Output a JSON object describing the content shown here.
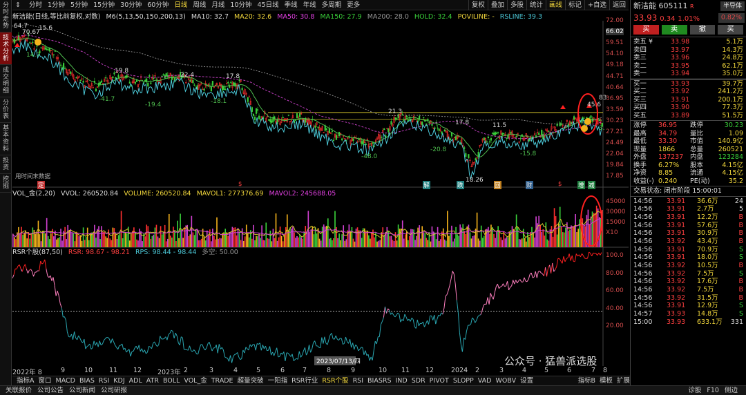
{
  "left_tabs": [
    "分时走势",
    "技术分析",
    "成交明细",
    "分价表",
    "基本资料",
    "投资",
    "挖掘"
  ],
  "top_periods": [
    "分时",
    "1分钟",
    "5分钟",
    "15分钟",
    "30分钟",
    "60分钟",
    "日线",
    "周线",
    "月线",
    "10分钟",
    "45日线",
    "季线",
    "年线",
    "多周期",
    "更多"
  ],
  "top_active": "日线",
  "top_buttons": [
    "复权",
    "叠加",
    "多股",
    "统计",
    "画线",
    "标记",
    "+自选",
    "返回"
  ],
  "legend": {
    "title": "新洁能(日线,等比前复权,对数)",
    "m6": "M6(5,13,50,150,200,13)",
    "ma10": "MA10: 32.7",
    "ma20": "MA20: 32.6",
    "ma50": "MA50: 30.8",
    "ma150": "MA150: 27.9",
    "ma200": "MA200: 28.0",
    "hold": "HOLD: 32.4",
    "poviline": "POVILINE: -",
    "rsline": "RSLINE: 39.3"
  },
  "price_axis": [
    "72.00",
    "66.02",
    "59.51",
    "54.10",
    "49.18",
    "44.71",
    "40.64",
    "36.95",
    "33.59",
    "30.23",
    "27.21",
    "24.49",
    "22.04",
    "19.84",
    "17.85"
  ],
  "price_labels": {
    "hi1": "64.7",
    "hi2": "70.67",
    "hi3": "15.6",
    "l1": "14.7",
    "p19_8": "19.8",
    "p22_4": "22.4",
    "p17_8": "17.8",
    "n41_7": "-41.7",
    "n19_4": "-19.4",
    "n18_1": "-18.1",
    "n48": "-48.0",
    "n20_8": "-20.8",
    "n15_8": "-15.8",
    "p17_8b": "17.8",
    "p11_5": "11.5",
    "low": "18.26",
    "p21_3": "21.3",
    "p45_6": "45.6",
    "p83": "83",
    "p3": "3."
  },
  "no_data_label": "用时间末数据",
  "vol_legend": {
    "name": "VOL_金(2,20)",
    "vvol": "VVOL: 260520.84",
    "volume": "VOLUME: 260520.84",
    "mavol1": "MAVOL1: 277376.69",
    "mavol2": "MAVOL2: 245688.05"
  },
  "vol_axis": [
    "45000",
    "30000",
    "15000",
    "X10"
  ],
  "rsr_legend": {
    "name": "RSR个股(87,50)",
    "rsr": "RSR: 98.67 - 98.21",
    "rps": "RPS: 98.44 - 98.44",
    "dk": "多空: 50.00"
  },
  "rsr_axis": [
    "100.0",
    "80.00",
    "60.00",
    "40.00",
    "20.00"
  ],
  "x_axis": [
    "2022年 8",
    "9",
    "10",
    "11",
    "12",
    "2023年",
    "2",
    "3",
    "4",
    "5",
    "6",
    "7",
    "8",
    "9",
    "10",
    "11",
    "12",
    "2024",
    "2",
    "3",
    "4",
    "5",
    "6",
    "7",
    "8"
  ],
  "x_tooltip": "2023/07/13/四",
  "bottom_tabs": [
    "指标A",
    "窗口",
    "MACD",
    "BIAS",
    "RSI",
    "KDJ",
    "ADL",
    "ATR",
    "BOLL",
    "VOL_金",
    "TRADE",
    "超量突破",
    "一阳指",
    "RSR行业",
    "RSR个股",
    "RSI",
    "BIASRS",
    "IND",
    "SDR",
    "PIVOT",
    "SLOPP",
    "VAD",
    "WOBV",
    "设置"
  ],
  "bottom_active": "RSR个股",
  "bottom_right": [
    "指标B",
    "模板",
    "扩展"
  ],
  "status": [
    "关联报价",
    "公司公告",
    "公司新闻",
    "公司研报"
  ],
  "status_right": [
    "诊股",
    "F10",
    "侧边"
  ],
  "watermark": "公众号 · 猛兽派选股",
  "stock": {
    "name": "新洁能",
    "code": "605111",
    "r": "R",
    "sector": "半导体",
    "price": "33.93",
    "chg": "0.34",
    "pct": "1.01%",
    "pct2": "0.82%"
  },
  "trade_btns": [
    "买",
    "卖",
    "撤",
    "买"
  ],
  "sell": [
    [
      "卖五",
      "¥",
      "33.98",
      "5.1万"
    ],
    [
      "卖四",
      "",
      "33.97",
      "14.3万"
    ],
    [
      "卖三",
      "",
      "33.96",
      "24.8万"
    ],
    [
      "卖二",
      "",
      "33.95",
      "62.1万"
    ],
    [
      "卖一",
      "",
      "33.94",
      "35.0万"
    ]
  ],
  "buy": [
    [
      "买一",
      "33.93",
      "39.7万"
    ],
    [
      "买二",
      "33.92",
      "241.2万"
    ],
    [
      "买三",
      "33.91",
      "200.1万"
    ],
    [
      "买四",
      "33.90",
      "77.3万"
    ],
    [
      "买五",
      "33.89",
      "51.5万"
    ]
  ],
  "stats": [
    [
      "涨停",
      "36.95",
      "跌停",
      "30.23"
    ],
    [
      "最高",
      "34.79",
      "量比",
      "1.09"
    ],
    [
      "最低",
      "33.30",
      "市值",
      "140.9亿"
    ],
    [
      "现量",
      "1866",
      "总量",
      "260521"
    ],
    [
      "外盘",
      "137237",
      "内盘",
      "123284"
    ],
    [
      "换手",
      "6.27%",
      "股本",
      "4.15亿"
    ],
    [
      "净资",
      "8.85",
      "流通",
      "4.15亿"
    ],
    [
      "收益(-)",
      "0.240",
      "PE(动)",
      "35.2"
    ]
  ],
  "trade_state": "交易状态: 闭市阶段 15:00:01",
  "ticks": [
    [
      "14:56",
      "33.91",
      "36.6万",
      "24"
    ],
    [
      "14:56",
      "33.91",
      "2.7万",
      "5"
    ],
    [
      "14:56",
      "33.91",
      "12.2万",
      "B"
    ],
    [
      "14:56",
      "33.91",
      "57.6万",
      "B"
    ],
    [
      "14:56",
      "33.91",
      "30.9万",
      "B"
    ],
    [
      "14:56",
      "33.92",
      "43.4万",
      "B"
    ],
    [
      "14:56",
      "33.91",
      "70.9万",
      "S"
    ],
    [
      "14:56",
      "33.91",
      "18.0万",
      "S"
    ],
    [
      "14:56",
      "33.92",
      "10.5万",
      "B"
    ],
    [
      "14:56",
      "33.92",
      "7.5万",
      "S"
    ],
    [
      "14:56",
      "33.92",
      "17.6万",
      "B"
    ],
    [
      "14:56",
      "33.92",
      "7.5万",
      "B"
    ],
    [
      "14:56",
      "33.92",
      "31.5万",
      "B"
    ],
    [
      "14:56",
      "33.91",
      "12.9万",
      "S"
    ],
    [
      "14:57",
      "33.93",
      "14.8万",
      "S"
    ],
    [
      "15:00",
      "33.93",
      "633.1万",
      "331"
    ]
  ]
}
